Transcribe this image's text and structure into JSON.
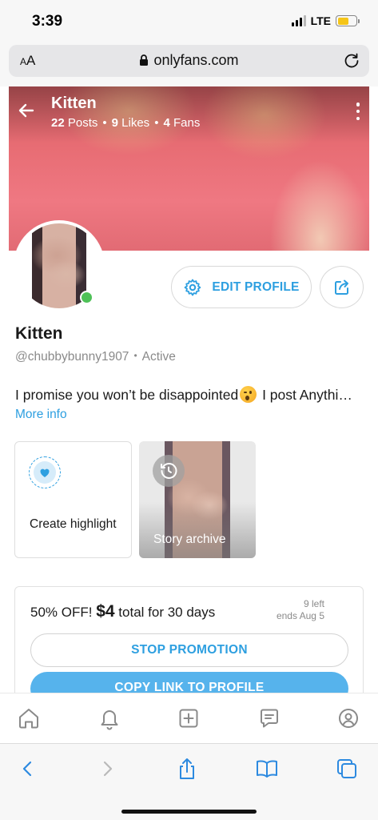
{
  "status_bar": {
    "time": "3:39",
    "network": "LTE",
    "battery_color": "#f5c518"
  },
  "browser": {
    "text_size_label": "AA",
    "url": "onlyfans.com"
  },
  "cover": {
    "name": "Kitten",
    "posts_count": "22",
    "posts_label": "Posts",
    "likes_count": "9",
    "likes_label": "Likes",
    "fans_count": "4",
    "fans_label": "Fans"
  },
  "profile": {
    "edit_label": "EDIT PROFILE",
    "name": "Kitten",
    "handle": "@chubbybunny1907",
    "status": "Active",
    "bio_before": "I promise you won’t be disappointed",
    "bio_after": " I post Anythi…",
    "more_info": "More info"
  },
  "highlights": {
    "create_label": "Create highlight",
    "archive_label": "Story archive"
  },
  "promotion": {
    "prefix": "50% OFF!",
    "price": "$4",
    "suffix": "total for 30 days",
    "left": "9 left",
    "ends": "ends Aug 5",
    "stop_label": "STOP PROMOTION",
    "copy_label": "COPY LINK TO PROFILE"
  },
  "colors": {
    "accent": "#2d9fe0",
    "online": "#4ec157",
    "button_fill": "#56b3ec"
  }
}
